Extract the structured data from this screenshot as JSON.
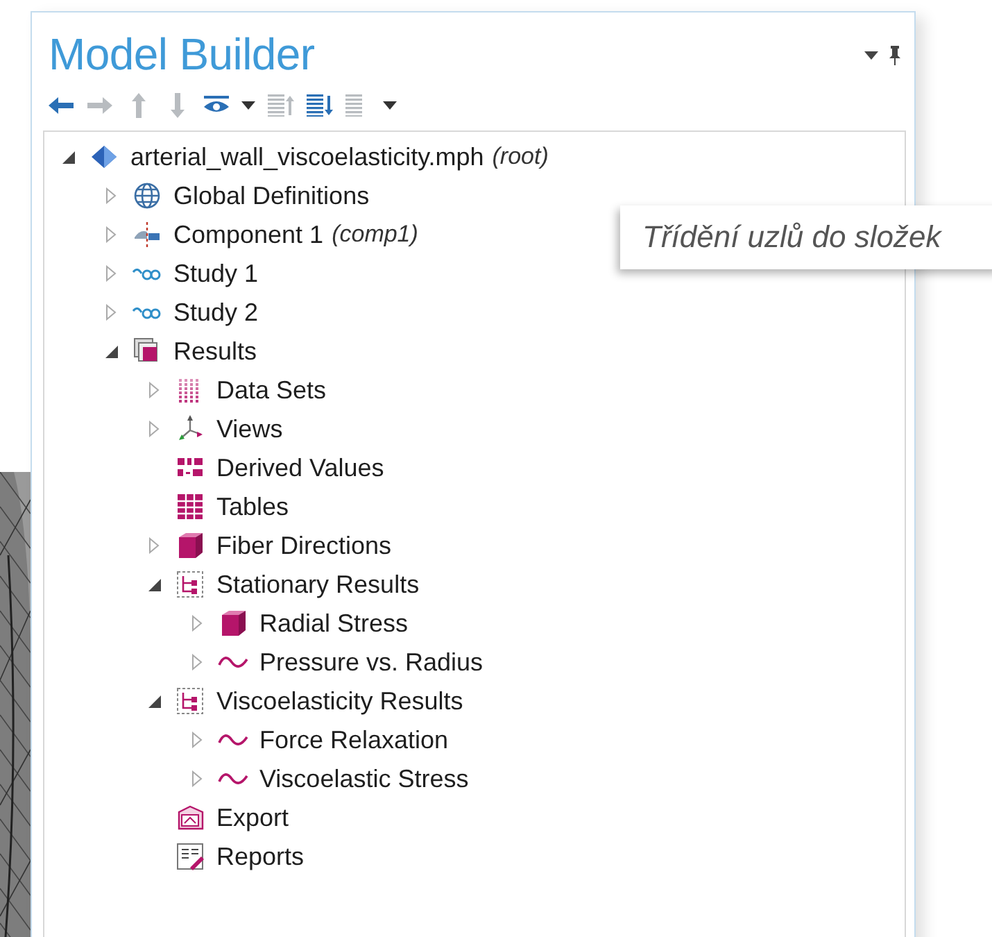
{
  "panel": {
    "title": "Model Builder"
  },
  "toolbar": [
    {
      "kind": "back",
      "disabled": false
    },
    {
      "kind": "forward",
      "disabled": true
    },
    {
      "kind": "up",
      "disabled": true
    },
    {
      "kind": "down",
      "disabled": true
    },
    {
      "kind": "eye",
      "disabled": false
    },
    {
      "kind": "caret"
    },
    {
      "kind": "collapse",
      "disabled": true
    },
    {
      "kind": "expand",
      "disabled": false
    },
    {
      "kind": "list",
      "disabled": true
    },
    {
      "kind": "caret"
    }
  ],
  "tree": [
    {
      "label": "arterial_wall_viscoelasticity.mph",
      "tag": "(root)",
      "kind": "root",
      "expanded": true,
      "children": [
        {
          "label": "Global Definitions",
          "kind": "globe",
          "expanded": false
        },
        {
          "label": "Component 1",
          "tag": "(comp1)",
          "kind": "component",
          "expanded": false
        },
        {
          "label": "Study 1",
          "kind": "study",
          "expanded": false
        },
        {
          "label": "Study 2",
          "kind": "study",
          "expanded": false
        },
        {
          "label": "Results",
          "kind": "results",
          "expanded": true,
          "children": [
            {
              "label": "Data Sets",
              "kind": "datasets",
              "expanded": false
            },
            {
              "label": "Views",
              "kind": "views",
              "expanded": false
            },
            {
              "label": "Derived Values",
              "kind": "derived"
            },
            {
              "label": "Tables",
              "kind": "table"
            },
            {
              "label": "Fiber Directions",
              "kind": "cube",
              "expanded": false
            },
            {
              "label": "Stationary Results",
              "kind": "group",
              "expanded": true,
              "children": [
                {
                  "label": "Radial Stress",
                  "kind": "cube",
                  "expanded": false
                },
                {
                  "label": "Pressure vs. Radius",
                  "kind": "plot",
                  "expanded": false
                }
              ]
            },
            {
              "label": "Viscoelasticity Results",
              "kind": "group",
              "expanded": true,
              "children": [
                {
                  "label": "Force Relaxation",
                  "kind": "plot",
                  "expanded": false
                },
                {
                  "label": "Viscoelastic Stress",
                  "kind": "plot",
                  "expanded": false
                }
              ]
            },
            {
              "label": "Export",
              "kind": "export"
            },
            {
              "label": "Reports",
              "kind": "reports"
            }
          ]
        }
      ]
    }
  ],
  "callout": {
    "text": "Třídění uzlů do složek"
  }
}
